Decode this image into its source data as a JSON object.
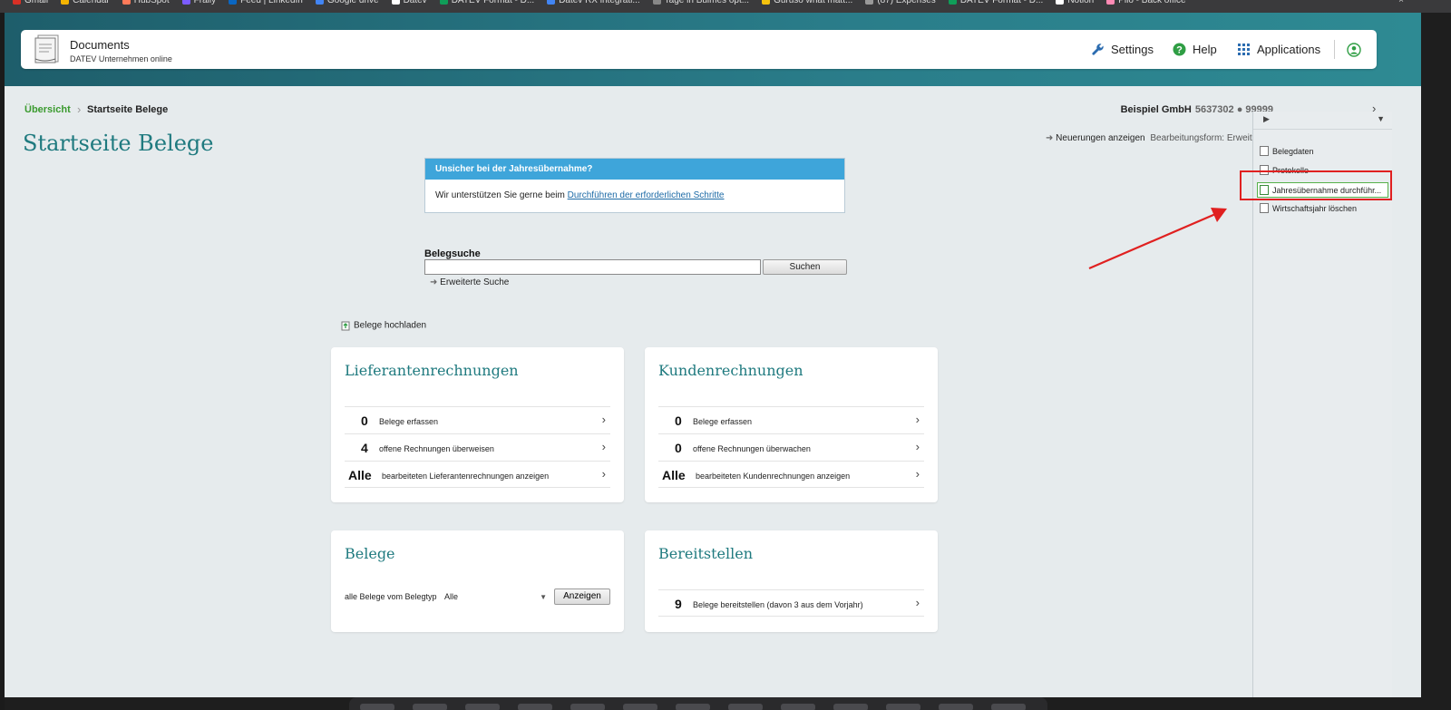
{
  "browser": {
    "bookmarks": [
      {
        "label": "Gmail",
        "color": "#d93025"
      },
      {
        "label": "Calendar",
        "color": "#f4b400"
      },
      {
        "label": "HubSpot",
        "color": "#ff7a59"
      },
      {
        "label": "Fraily",
        "color": "#7b5cff"
      },
      {
        "label": "Feed | LinkedIn",
        "color": "#0a66c2"
      },
      {
        "label": "Google drive",
        "color": "#4285f4"
      },
      {
        "label": "Datev",
        "color": "#ffffff"
      },
      {
        "label": "DATEV Format - D...",
        "color": "#0f9d58"
      },
      {
        "label": "Datev RX integrati...",
        "color": "#4285f4"
      },
      {
        "label": "Tage in Bulmes opt...",
        "color": "#888888"
      },
      {
        "label": "Guruso what matt...",
        "color": "#f4c20d"
      },
      {
        "label": "(87) Expenses",
        "color": "#999999"
      },
      {
        "label": "DATEV Format - D...",
        "color": "#0f9d58"
      },
      {
        "label": "Notion",
        "color": "#ffffff"
      },
      {
        "label": "Pilo - Back office",
        "color": "#ff8ab4"
      }
    ]
  },
  "header": {
    "app_title": "Documents",
    "app_subtitle": "DATEV Unternehmen online",
    "settings_label": "Settings",
    "help_label": "Help",
    "applications_label": "Applications"
  },
  "breadcrumb": {
    "home": "Übersicht",
    "current": "Startseite Belege"
  },
  "company": {
    "name": "Beispiel GmbH",
    "numbers": "5637302 ● 99999"
  },
  "page": {
    "title": "Startseite Belege",
    "neuerungen_label": "Neuerungen anzeigen",
    "bearbeitungsform": "Bearbeitungsform: Erweitert"
  },
  "info": {
    "heading": "Unsicher bei der Jahresübernahme?",
    "text": "Wir unterstützen Sie gerne beim ",
    "link": "Durchführen der erforderlichen Schritte"
  },
  "search": {
    "label": "Belegsuche",
    "value": "",
    "button": "Suchen",
    "advanced": "Erweiterte Suche"
  },
  "upload_label": "Belege hochladen",
  "cards": {
    "lieferanten": {
      "title": "Lieferantenrechnungen",
      "rows": [
        {
          "num": "0",
          "text": "Belege erfassen"
        },
        {
          "num": "4",
          "text": "offene Rechnungen überweisen"
        },
        {
          "num": "Alle",
          "text": "bearbeiteten Lieferantenrechnungen anzeigen"
        }
      ]
    },
    "kunden": {
      "title": "Kundenrechnungen",
      "rows": [
        {
          "num": "0",
          "text": "Belege erfassen"
        },
        {
          "num": "0",
          "text": "offene Rechnungen überwachen"
        },
        {
          "num": "Alle",
          "text": "bearbeiteten Kundenrechnungen anzeigen"
        }
      ]
    },
    "belege": {
      "title": "Belege",
      "belegtyp_label": "alle Belege vom Belegtyp",
      "belegtyp_value": "Alle",
      "button": "Anzeigen"
    },
    "bereitstellen": {
      "title": "Bereitstellen",
      "rows": [
        {
          "num": "9",
          "text": "Belege bereitstellen (davon 3 aus dem Vorjahr)"
        }
      ]
    }
  },
  "sidepanel": {
    "items": [
      {
        "label": "Belegdaten"
      },
      {
        "label": "Protokolle"
      },
      {
        "label": "Jahresübernahme durchführ..."
      },
      {
        "label": "Wirtschaftsjahr löschen"
      }
    ]
  },
  "colors": {
    "accent_teal": "#1f7a7f",
    "link_green": "#3a9a2e",
    "info_blue": "#3ea5da",
    "annotation_red": "#e02020"
  }
}
